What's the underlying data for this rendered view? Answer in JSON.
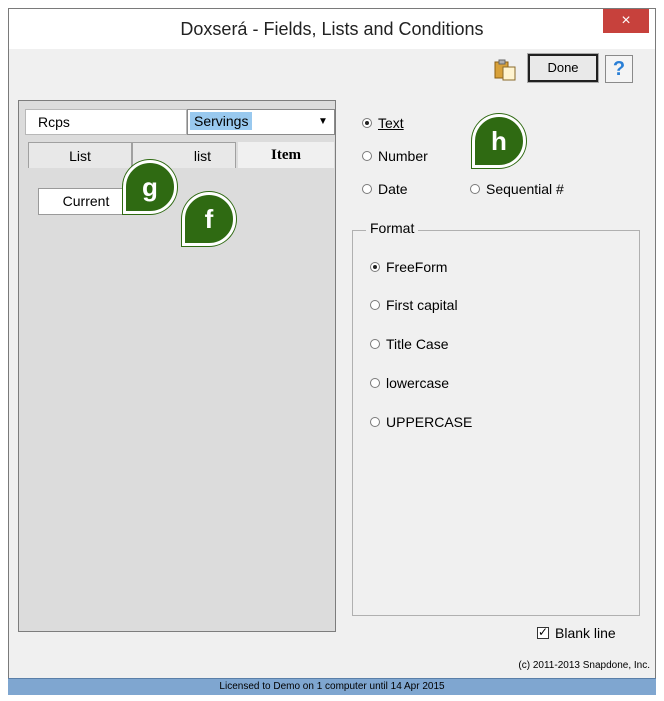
{
  "window": {
    "title": "Doxserá - Fields, Lists and Conditions",
    "close_label": "×"
  },
  "toolbar": {
    "done_label": "Done",
    "help_label": "?"
  },
  "left": {
    "rcps_value": "Rcps",
    "combo_selected": "Servings",
    "tabs": [
      "List",
      "list",
      "Item"
    ],
    "subtab_label": "Current"
  },
  "type_options": {
    "text": "Text",
    "number": "Number",
    "date": "Date",
    "sequential": "Sequential #",
    "selected": "Text"
  },
  "format": {
    "legend": "Format",
    "options": [
      "FreeForm",
      "First capital",
      "Title Case",
      "lowercase",
      "UPPERCASE"
    ],
    "selected": "FreeForm"
  },
  "blank_line": {
    "label": "Blank line",
    "checked": true
  },
  "copyright": "(c) 2011-2013 Snapdone, Inc.",
  "status_bar": "Licensed to Demo on 1 computer until 14 Apr 2015",
  "callouts": [
    "h",
    "g",
    "f"
  ]
}
